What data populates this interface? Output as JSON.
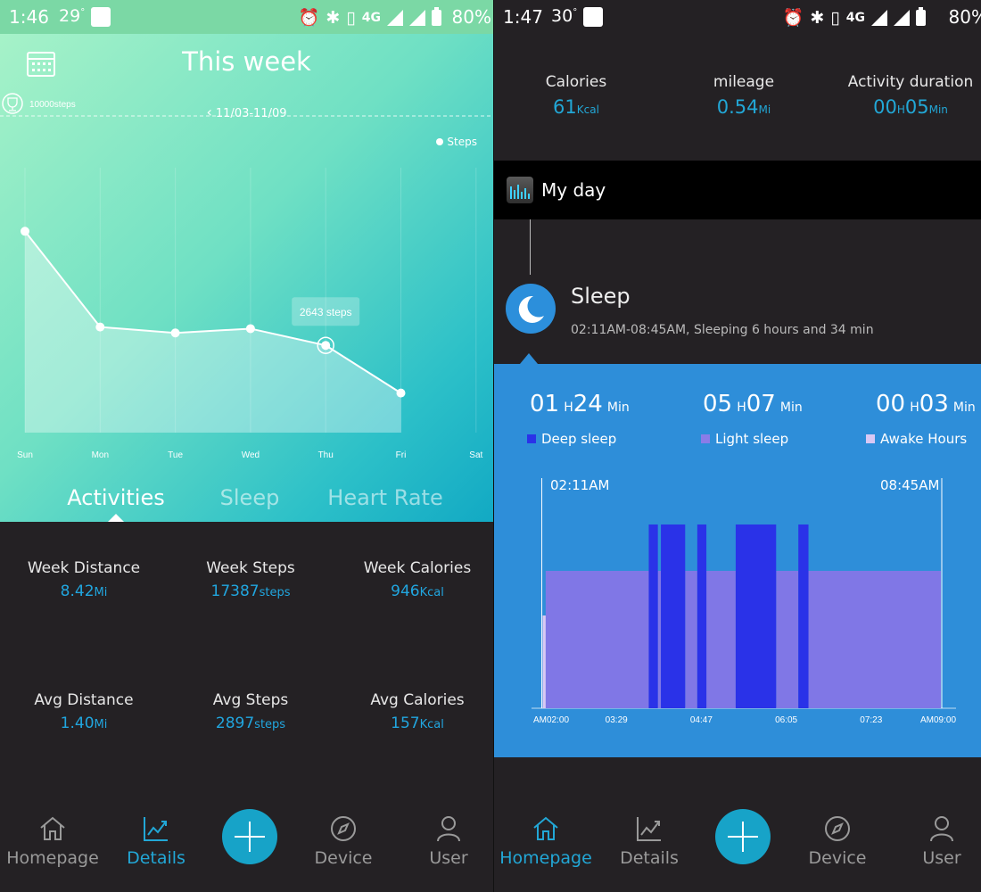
{
  "left": {
    "status": {
      "time": "1:46",
      "temp": "29",
      "temp_unit": "°",
      "battery": "80%",
      "network": "4G"
    },
    "header": {
      "title": "This week",
      "date_range": "11/03-11/09",
      "legend_label": "Steps",
      "goal_label": "10000steps",
      "tooltip": "2643 steps"
    },
    "chart_data": {
      "type": "area",
      "categories": [
        "Sun",
        "Mon",
        "Tue",
        "Wed",
        "Thu",
        "Fri",
        "Sat"
      ],
      "series": [
        {
          "name": "Steps",
          "values": [
            6100,
            3200,
            3020,
            3150,
            2643,
            1200,
            null
          ]
        }
      ],
      "goal": 10000,
      "ylim": [
        0,
        11000
      ],
      "highlight_index": 4,
      "legend_position": "top-right",
      "grid": true
    },
    "tabs": [
      {
        "label": "Activities",
        "active": true
      },
      {
        "label": "Sleep",
        "active": false
      },
      {
        "label": "Heart Rate",
        "active": false
      }
    ],
    "stats": [
      {
        "label": "Week Distance",
        "value": "8.42",
        "unit": "Mi"
      },
      {
        "label": "Week Steps",
        "value": "17387",
        "unit": "steps"
      },
      {
        "label": "Week Calories",
        "value": "946",
        "unit": "Kcal"
      },
      {
        "label": "Avg Distance",
        "value": "1.40",
        "unit": "Mi"
      },
      {
        "label": "Avg Steps",
        "value": "2897",
        "unit": "steps"
      },
      {
        "label": "Avg Calories",
        "value": "157",
        "unit": "Kcal"
      }
    ],
    "nav": [
      {
        "label": "Homepage",
        "active": false
      },
      {
        "label": "Details",
        "active": true
      },
      {
        "label": "Device",
        "active": false
      },
      {
        "label": "User",
        "active": false
      }
    ]
  },
  "right": {
    "status": {
      "time": "1:47",
      "temp": "30",
      "temp_unit": "°",
      "battery": "80%",
      "network": "4G"
    },
    "summary": [
      {
        "label": "Calories",
        "value": "61",
        "unit": "Kcal"
      },
      {
        "label": "mileage",
        "value": "0.54",
        "unit": "Mi"
      },
      {
        "label": "Activity duration",
        "value_h": "00",
        "unit_h": "H",
        "value_m": "05",
        "unit_m": "Min"
      }
    ],
    "myday_title": "My day",
    "sleep": {
      "title": "Sleep",
      "subtitle": "02:11AM-08:45AM, Sleeping 6 hours and 34 min",
      "durations": [
        {
          "h": "01",
          "m": "24",
          "legend": "Deep sleep",
          "color": "#2a32e8"
        },
        {
          "h": "05",
          "m": "07",
          "legend": "Light sleep",
          "color": "#8a7ce8"
        },
        {
          "h": "00",
          "m": "03",
          "legend": "Awake Hours",
          "color": "#d9c8f4"
        }
      ],
      "h_unit": "H",
      "m_unit": "Min",
      "start_label": "02:11AM",
      "end_label": "08:45AM",
      "chart_data": {
        "type": "bar",
        "x_ticks": [
          "AM02:00",
          "03:29",
          "04:47",
          "06:05",
          "07:23",
          "AM09:00"
        ],
        "x_range_minutes": [
          120,
          540
        ],
        "sleep_start_minutes": 131,
        "sleep_end_minutes": 525,
        "segments": [
          {
            "stage": "Awake",
            "start": 131,
            "end": 134
          },
          {
            "stage": "Light",
            "start": 134,
            "end": 236
          },
          {
            "stage": "Deep",
            "start": 236,
            "end": 245
          },
          {
            "stage": "Light",
            "start": 245,
            "end": 248
          },
          {
            "stage": "Deep",
            "start": 248,
            "end": 272
          },
          {
            "stage": "Light",
            "start": 272,
            "end": 284
          },
          {
            "stage": "Deep",
            "start": 284,
            "end": 293
          },
          {
            "stage": "Light",
            "start": 293,
            "end": 322
          },
          {
            "stage": "Deep",
            "start": 322,
            "end": 362
          },
          {
            "stage": "Light",
            "start": 362,
            "end": 384
          },
          {
            "stage": "Deep",
            "start": 384,
            "end": 394
          },
          {
            "stage": "Light",
            "start": 394,
            "end": 525
          }
        ],
        "stage_colors": {
          "Deep": "#2a32e8",
          "Light": "#8077e6",
          "Awake": "#d9c8f4"
        }
      }
    },
    "nav": [
      {
        "label": "Homepage",
        "active": true
      },
      {
        "label": "Details",
        "active": false
      },
      {
        "label": "Device",
        "active": false
      },
      {
        "label": "User",
        "active": false
      }
    ]
  }
}
